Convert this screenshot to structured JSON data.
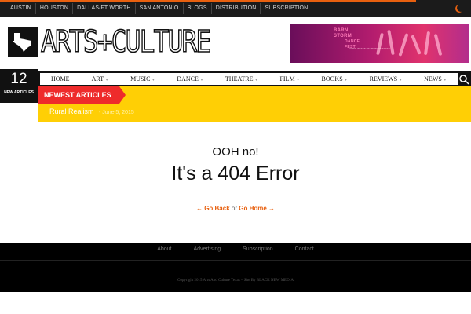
{
  "topnav": [
    "AUSTIN",
    "HOUSTON",
    "DALLAS/FT WORTH",
    "SAN ANTONIO",
    "BLOGS",
    "DISTRIBUTION",
    "SUBSCRIPTION"
  ],
  "logo": {
    "text": "ARTS+CULTURE",
    "icon": "texas-icon"
  },
  "ad": {
    "line1": "BARN",
    "line2": "STORM",
    "line3": "DANCE",
    "line4": "FEST",
    "sub": "THREE WEEKS OF PERFORMANCES"
  },
  "date": {
    "day": "12",
    "label": "NEW ARTICLES"
  },
  "mainnav": [
    "HOME",
    "ART",
    "MUSIC",
    "DANCE",
    "THEATRE",
    "FILM",
    "BOOKS",
    "REVIEWS",
    "NEWS"
  ],
  "ticker": {
    "label": "NEWEST ARTICLES",
    "item": "Rural Realism",
    "date": "- June 5, 2015"
  },
  "error": {
    "small": "OOH no!",
    "big": "It's a 404 Error",
    "back": "Go Back",
    "or": "or",
    "home": "Go Home"
  },
  "footer": {
    "links": [
      "About",
      "Advertising",
      "Subscription",
      "Contact"
    ],
    "copyright": "Copyright 2015 Arts And Culture Texas – Site By BLACK NEW MEDIA"
  },
  "colors": {
    "accent": "#e8600f",
    "ticker_bg": "#ffcf05",
    "ticker_label": "#ee2b2b"
  }
}
